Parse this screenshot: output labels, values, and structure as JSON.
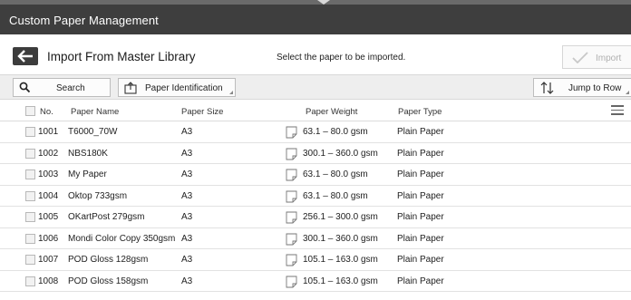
{
  "window": {
    "title": "Custom Paper Management"
  },
  "header": {
    "title": "Import From Master Library",
    "hint": "Select the paper to be imported.",
    "import_label": "Import"
  },
  "toolbar": {
    "search_label": "Search",
    "paper_id_label": "Paper Identification",
    "jump_label": "Jump to Row"
  },
  "table": {
    "columns": {
      "no": "No.",
      "name": "Paper Name",
      "size": "Paper Size",
      "weight": "Paper Weight",
      "type": "Paper Type"
    },
    "rows": [
      {
        "no": "1001",
        "name": "T6000_70W",
        "size": "A3",
        "weight": "63.1 – 80.0 gsm",
        "type": "Plain Paper"
      },
      {
        "no": "1002",
        "name": "NBS180K",
        "size": "A3",
        "weight": "300.1 – 360.0 gsm",
        "type": "Plain Paper"
      },
      {
        "no": "1003",
        "name": "My Paper",
        "size": "A3",
        "weight": "63.1 – 80.0 gsm",
        "type": "Plain Paper"
      },
      {
        "no": "1004",
        "name": "Oktop 733gsm",
        "size": "A3",
        "weight": "63.1 – 80.0 gsm",
        "type": "Plain Paper"
      },
      {
        "no": "1005",
        "name": "OKartPost 279gsm",
        "size": "A3",
        "weight": "256.1 – 300.0 gsm",
        "type": "Plain Paper"
      },
      {
        "no": "1006",
        "name": "Mondi Color Copy 350gsm",
        "size": "A3",
        "weight": "300.1 – 360.0 gsm",
        "type": "Plain Paper"
      },
      {
        "no": "1007",
        "name": "POD Gloss 128gsm",
        "size": "A3",
        "weight": "105.1 – 163.0 gsm",
        "type": "Plain Paper"
      },
      {
        "no": "1008",
        "name": "POD Gloss 158gsm",
        "size": "A3",
        "weight": "105.1 – 163.0 gsm",
        "type": "Plain Paper"
      }
    ]
  },
  "icons": {
    "back": "back-arrow-icon",
    "import": "checkmark-icon",
    "search": "search-icon",
    "paper_id": "paper-identification-icon",
    "jump": "sort-arrows-icon",
    "menu": "menu-icon",
    "weight": "paper-sheet-icon"
  },
  "colors": {
    "titlebar": "#3e3e3e",
    "toolbar": "#eeeeee",
    "disabled_text": "#b0b0b0"
  }
}
